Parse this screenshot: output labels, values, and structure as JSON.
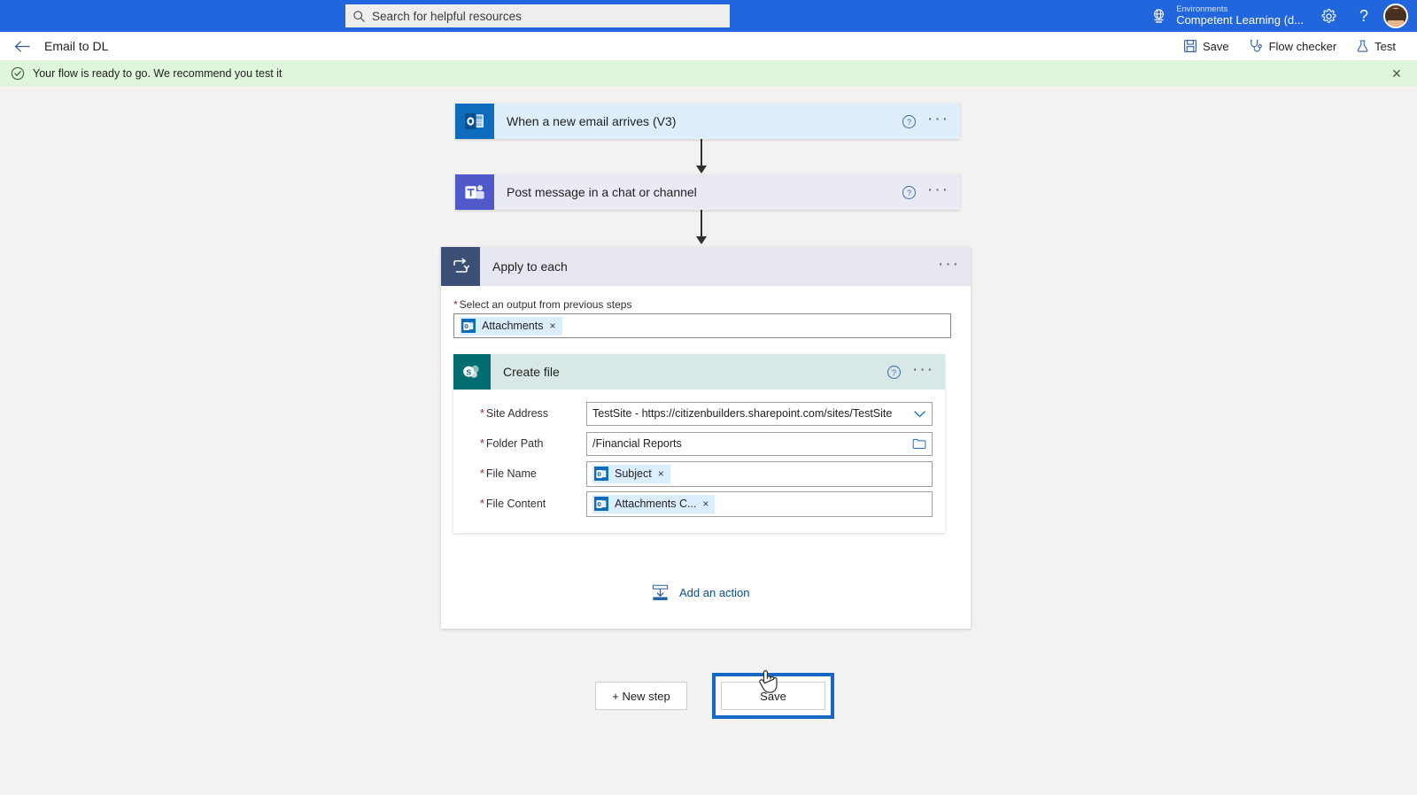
{
  "suite_bar": {
    "search": {
      "placeholder": "Search for helpful resources",
      "value": "",
      "icon": "search-icon"
    },
    "environment": {
      "label": "Environments",
      "value": "Competent Learning (d...",
      "icon": "environment-globe-icon"
    },
    "settings_icon": "gear-icon",
    "help_icon": "question-mark-icon",
    "avatar": "user-avatar",
    "accent_color": "#2266dd"
  },
  "command_bar": {
    "back_icon": "back-arrow-icon",
    "flow_title": "Email to DL",
    "actions": [
      {
        "label": "Save",
        "icon": "save-floppy-icon"
      },
      {
        "label": "Flow checker",
        "icon": "stethoscope-icon"
      },
      {
        "label": "Test",
        "icon": "flask-icon"
      }
    ]
  },
  "banner": {
    "icon": "check-circle-icon",
    "message": "Your flow is ready to go. We recommend you test it",
    "close_label": "✕",
    "background_color": "#dff6dd"
  },
  "flow": {
    "trigger": {
      "title": "When a new email arrives (V3)",
      "connector_icon": "outlook-icon",
      "help_icon": "help-circle-icon",
      "menu_icon": "ellipsis-icon",
      "header_color": "#dfeefb",
      "icon_color": "#0f6cbd"
    },
    "action_teams": {
      "title": "Post message in a chat or channel",
      "connector_icon": "teams-icon",
      "help_icon": "help-circle-icon",
      "menu_icon": "ellipsis-icon",
      "header_color": "#eaeaf5",
      "icon_color": "#5059c9"
    },
    "scope": {
      "title": "Apply to each",
      "icon": "loop-icon",
      "menu_icon": "ellipsis-icon",
      "header_color": "#e6e7f0",
      "icon_color": "#3b5075",
      "input_label": "Select an output from previous steps",
      "input_required": "*",
      "input_token": {
        "text": "Attachments",
        "remove": "×",
        "icon": "outlook-icon"
      }
    },
    "create_file": {
      "title": "Create file",
      "connector_icon": "sharepoint-icon",
      "help_icon": "help-circle-icon",
      "menu_icon": "ellipsis-icon",
      "header_color": "#d7e8e6",
      "icon_color": "#036c70",
      "fields": [
        {
          "label": "Site Address",
          "required": "*",
          "type": "dropdown",
          "value": "TestSite - https://citizenbuilders.sharepoint.com/sites/TestSite",
          "icon": "chevron-down-icon"
        },
        {
          "label": "Folder Path",
          "required": "*",
          "type": "picker",
          "value": "/Financial Reports",
          "icon": "folder-browse-icon"
        },
        {
          "label": "File Name",
          "required": "*",
          "type": "token",
          "token": {
            "text": "Subject",
            "remove": "×",
            "icon": "outlook-icon"
          }
        },
        {
          "label": "File Content",
          "required": "*",
          "type": "token",
          "token": {
            "text": "Attachments C...",
            "remove": "×",
            "icon": "outlook-icon"
          }
        }
      ]
    },
    "add_action": {
      "label": "Add an action",
      "icon": "insert-action-icon"
    }
  },
  "footer": {
    "new_step_label": "+ New step",
    "save_label": "Save",
    "save_highlight_color": "#1668c5"
  }
}
